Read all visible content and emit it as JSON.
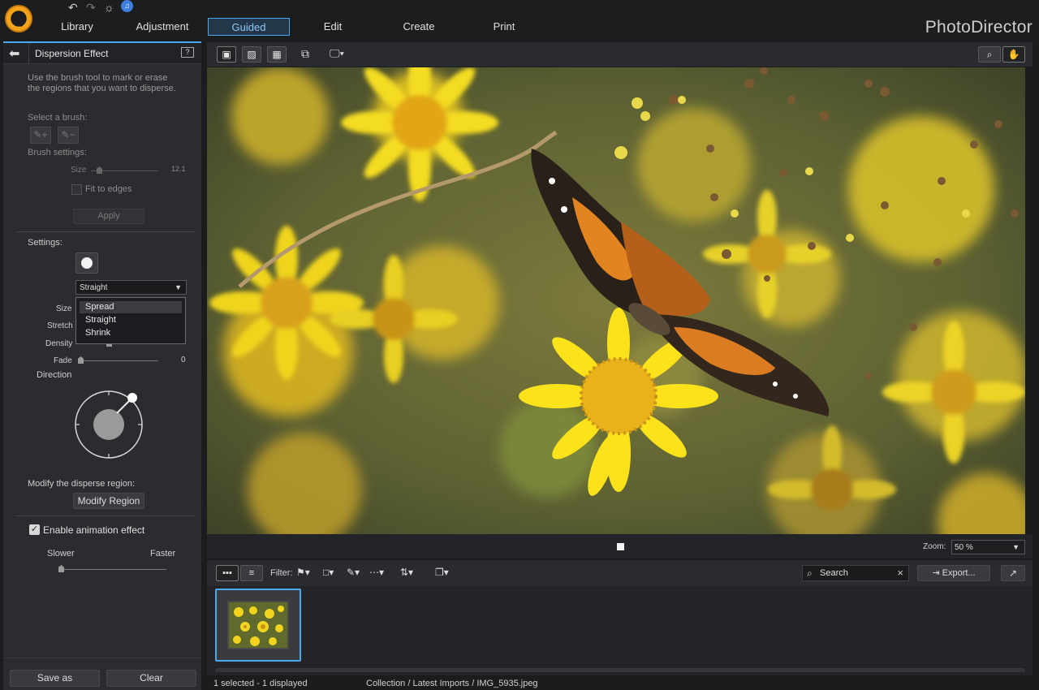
{
  "app": {
    "brand": "PhotoDirector"
  },
  "tabs": [
    {
      "label": "Library"
    },
    {
      "label": "Adjustment"
    },
    {
      "label": "Guided"
    },
    {
      "label": "Edit"
    },
    {
      "label": "Create"
    },
    {
      "label": "Print"
    }
  ],
  "active_tab": "Guided",
  "panel": {
    "title": "Dispersion Effect",
    "help_icon": "?",
    "instructions": "Use the brush tool to mark or erase the regions that you want to disperse.",
    "select_brush_label": "Select a brush:",
    "brush_settings_label": "Brush settings:",
    "size_label": "Size",
    "size_value": "12.1",
    "fit_to_edges_label": "Fit to edges",
    "apply_label": "Apply",
    "settings_label": "Settings:",
    "mode_selected": "Straight",
    "mode_options": [
      "Spread",
      "Straight",
      "Shrink"
    ],
    "highlighted_option": "Spread",
    "sliders": [
      {
        "label": "Size",
        "value": ""
      },
      {
        "label": "Stretch",
        "value": ""
      },
      {
        "label": "Density",
        "value": ""
      },
      {
        "label": "Fade",
        "value": "0"
      }
    ],
    "direction_label": "Direction",
    "modify_region_label": "Modify the disperse region:",
    "modify_region_button": "Modify Region",
    "enable_animation_label": "Enable animation effect",
    "enable_animation_checked": true,
    "slower_label": "Slower",
    "faster_label": "Faster",
    "save_as_label": "Save as",
    "clear_label": "Clear"
  },
  "viewer": {
    "zoom_label": "Zoom:",
    "zoom_value": "50 %"
  },
  "filmstrip": {
    "filter_label": "Filter:",
    "search_placeholder": "Search",
    "export_label": "Export..."
  },
  "status": {
    "selection": "1 selected - 1 displayed",
    "path": "Collection / Latest Imports / IMG_5935.jpeg"
  },
  "colors": {
    "accent": "#4ea7e8",
    "panel_bg": "#2b2c2f",
    "brand_orange": "#f2a31a"
  }
}
